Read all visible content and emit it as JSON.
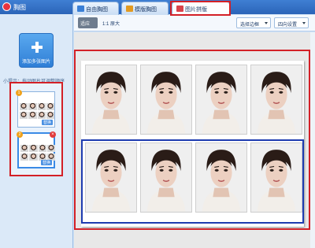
{
  "window": {
    "title": "胸图"
  },
  "tabs": [
    {
      "label": "自由胸图",
      "icon": "photo-icon",
      "color": "#3a7fd6"
    },
    {
      "label": "模版胸图",
      "icon": "template-icon",
      "color": "#e29a21"
    },
    {
      "label": "图片拼版",
      "icon": "layout-icon",
      "color": "#d9434b",
      "active": true
    }
  ],
  "sidebar": {
    "add_button_label": "添加多张图片",
    "hint": "小提示：拖动图片可调整顺序",
    "thumbnails": [
      {
        "badge": "1",
        "replace_label": "替换"
      },
      {
        "badge": "2",
        "replace_label": "替换"
      }
    ]
  },
  "toolbar": {
    "fit_label": "适应",
    "actual_label": "1:1 原大",
    "border_select": "选择边框",
    "print_select": "四向设置"
  },
  "layout": {
    "rows": 2,
    "columns": 4,
    "accent": "#d32027",
    "selection_color": "#1e3cb0"
  }
}
